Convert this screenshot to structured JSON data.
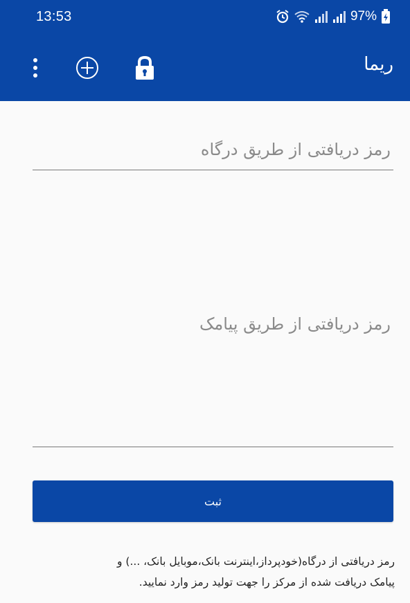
{
  "status_bar": {
    "time": "13:53",
    "battery": "97%",
    "icons": [
      "alarm-icon",
      "wifi-icon",
      "signal-icon",
      "signal-icon",
      "battery-icon"
    ]
  },
  "app_bar": {
    "title": "ریما",
    "icons": [
      "more-vert-icon",
      "add-circle-icon",
      "lock-icon"
    ]
  },
  "form": {
    "portal_placeholder": "رمز دریافتی از طریق درگاه",
    "portal_value": "",
    "sms_placeholder": "رمز دریافتی از طریق پیامک",
    "sms_value": "",
    "submit_label": "ثبت"
  },
  "help": {
    "line1": "رمز دریافتی از درگاه(خودپرداز،اینترنت بانک،موبایل بانک، ...) و",
    "line2": "پیامک دریافت شده از مرکز را جهت تولید رمز وارد نمایید."
  },
  "colors": {
    "primary": "#0a47a6",
    "background": "#fafafa",
    "underline": "#7a7a7a"
  }
}
